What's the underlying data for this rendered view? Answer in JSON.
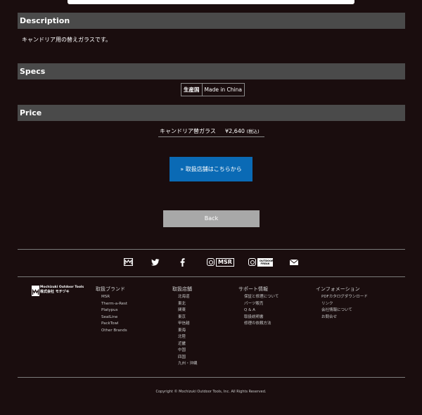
{
  "description": {
    "heading": "Description",
    "text": "キャンドリア用の替えガラスです。"
  },
  "specs": {
    "heading": "Specs",
    "rows": [
      {
        "label": "生産国",
        "value": "Made in China"
      }
    ]
  },
  "price": {
    "heading": "Price",
    "name": "キャンドリア替ガラス",
    "value": "¥2,640",
    "tax": "(税込)"
  },
  "buttons": {
    "shop": "» 取扱店舗はこちらから",
    "back": "Back"
  },
  "social": {
    "icons": [
      "mochizuki-logo-icon",
      "twitter-icon",
      "facebook-icon",
      "instagram-msr-icon",
      "instagram-outdoor-icon",
      "mail-icon"
    ],
    "msr_label": "MSR",
    "outdoor_label_1": "OUTDOOR",
    "outdoor_label_2": "FREAK"
  },
  "footer": {
    "logo": {
      "line1": "Mochizuki Outdoor Tools",
      "line2": "株式会社 モチヅキ"
    },
    "columns": [
      {
        "heading": "取扱ブランド",
        "items": [
          "MSR",
          "Therm-a-Rest",
          "Platypus",
          "SealLine",
          "PackTowl",
          "Other Brands"
        ]
      },
      {
        "heading": "取扱店舗",
        "items": [
          "北海道",
          "東北",
          "関東",
          "東京",
          "甲信越",
          "東海",
          "北陸",
          "近畿",
          "中国",
          "四国",
          "九州・沖縄"
        ]
      },
      {
        "heading": "サポート情報",
        "items": [
          "保証と修理について",
          "パーツ販売",
          "Q & A",
          "取扱説明書",
          "修理の依頼方法"
        ]
      },
      {
        "heading": "インフォメーション",
        "items": [
          "PDFカタログダウンロード",
          "リンク",
          "会社情報について",
          "お問合せ"
        ]
      }
    ],
    "copyright": "Copyright © Mochizuki Outdoor Tools, Inc. All Rights Reserved."
  }
}
